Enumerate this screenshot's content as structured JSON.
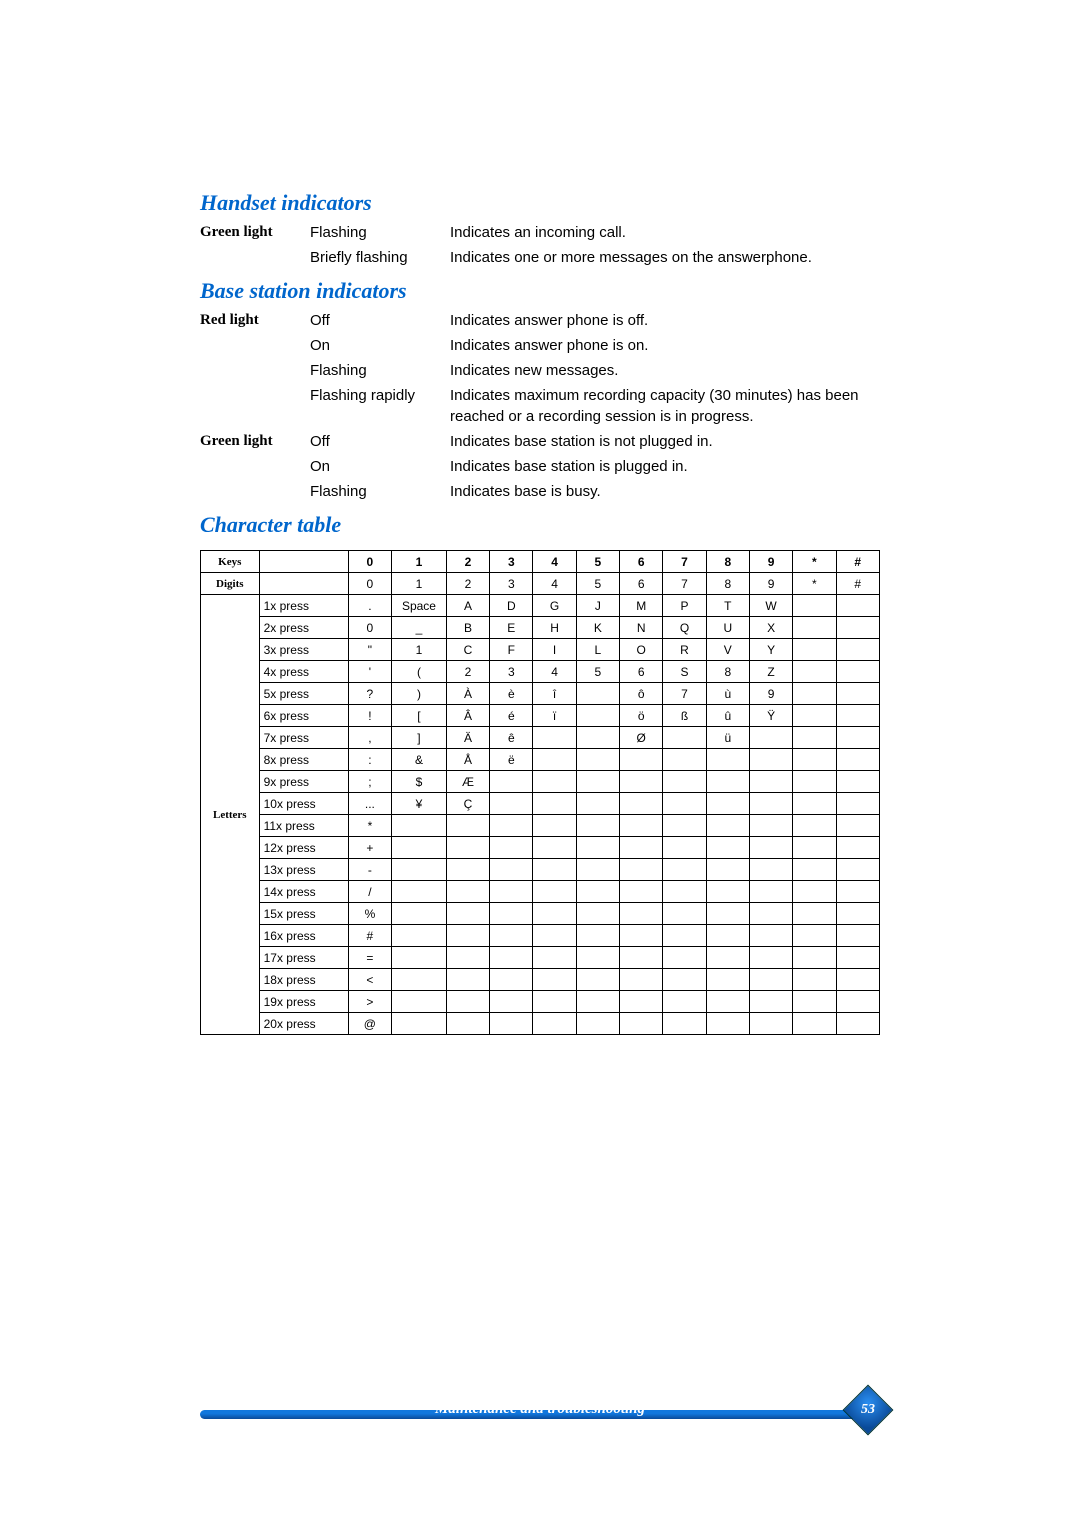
{
  "handset": {
    "title": "Handset indicators",
    "rows": [
      {
        "label": "Green light",
        "state": "Flashing",
        "desc": "Indicates an incoming call."
      },
      {
        "label": "",
        "state": "Briefly flashing",
        "desc": "Indicates one or more messages on the answerphone."
      }
    ]
  },
  "base": {
    "title": "Base station indicators",
    "rows": [
      {
        "label": "Red light",
        "state": "Off",
        "desc": "Indicates answer phone is off."
      },
      {
        "label": "",
        "state": "On",
        "desc": "Indicates answer phone is on."
      },
      {
        "label": "",
        "state": "Flashing",
        "desc": " Indicates new messages."
      },
      {
        "label": "",
        "state": "Flashing rapidly",
        "desc": " Indicates maximum recording capacity (30 minutes) has been reached or a recording session is in progress."
      },
      {
        "label": "Green light",
        "state": "Off",
        "desc": "Indicates base station is not plugged in."
      },
      {
        "label": "",
        "state": "On",
        "desc": "Indicates base station is plugged in."
      },
      {
        "label": "",
        "state": "Flashing",
        "desc": " Indicates base is busy."
      }
    ]
  },
  "chartable": {
    "title": "Character table",
    "headers": {
      "keys": "Keys",
      "digits": "Digits",
      "letters": "Letters",
      "cols": [
        "0",
        "1",
        "2",
        "3",
        "4",
        "5",
        "6",
        "7",
        "8",
        "9",
        "*",
        "#"
      ]
    },
    "digits_row": [
      "0",
      "1",
      "2",
      "3",
      "4",
      "5",
      "6",
      "7",
      "8",
      "9",
      "*",
      "#"
    ],
    "rows": [
      {
        "press": "1x press",
        "cells": [
          ".",
          "Space",
          "A",
          "D",
          "G",
          "J",
          "M",
          "P",
          "T",
          "W",
          "",
          ""
        ]
      },
      {
        "press": "2x press",
        "cells": [
          "0",
          "_",
          "B",
          "E",
          "H",
          "K",
          "N",
          "Q",
          "U",
          "X",
          "",
          ""
        ]
      },
      {
        "press": "3x press",
        "cells": [
          "\"",
          "1",
          "C",
          "F",
          "I",
          "L",
          "O",
          "R",
          "V",
          "Y",
          "",
          ""
        ]
      },
      {
        "press": "4x press",
        "cells": [
          "'",
          "(",
          "2",
          "3",
          "4",
          "5",
          "6",
          "S",
          "8",
          "Z",
          "",
          ""
        ]
      },
      {
        "press": "5x press",
        "cells": [
          "?",
          ")",
          "À",
          "è",
          "î",
          "",
          "ô",
          "7",
          "ù",
          "9",
          "",
          ""
        ]
      },
      {
        "press": "6x press",
        "cells": [
          "!",
          "[",
          "Â",
          "é",
          "ï",
          "",
          "ö",
          "ß",
          "û",
          "Ÿ",
          "",
          ""
        ]
      },
      {
        "press": "7x press",
        "cells": [
          ",",
          "]",
          "Ä",
          "ê",
          "",
          "",
          "Ø",
          "",
          "ü",
          "",
          "",
          ""
        ]
      },
      {
        "press": "8x press",
        "cells": [
          ":",
          "&",
          "Å",
          "ë",
          "",
          "",
          "",
          "",
          "",
          "",
          "",
          ""
        ]
      },
      {
        "press": "9x press",
        "cells": [
          ";",
          "$",
          "Æ",
          "",
          "",
          "",
          "",
          "",
          "",
          "",
          "",
          ""
        ]
      },
      {
        "press": "10x press",
        "cells": [
          "...",
          "¥",
          "Ç",
          "",
          "",
          "",
          "",
          "",
          "",
          "",
          "",
          ""
        ]
      },
      {
        "press": "11x press",
        "cells": [
          "*",
          "",
          "",
          "",
          "",
          "",
          "",
          "",
          "",
          "",
          "",
          ""
        ]
      },
      {
        "press": "12x press",
        "cells": [
          "+",
          "",
          "",
          "",
          "",
          "",
          "",
          "",
          "",
          "",
          "",
          ""
        ]
      },
      {
        "press": "13x press",
        "cells": [
          "-",
          "",
          "",
          "",
          "",
          "",
          "",
          "",
          "",
          "",
          "",
          ""
        ]
      },
      {
        "press": "14x press",
        "cells": [
          "/",
          "",
          "",
          "",
          "",
          "",
          "",
          "",
          "",
          "",
          "",
          ""
        ]
      },
      {
        "press": "15x press",
        "cells": [
          "%",
          "",
          "",
          "",
          "",
          "",
          "",
          "",
          "",
          "",
          "",
          ""
        ]
      },
      {
        "press": "16x press",
        "cells": [
          "#",
          "",
          "",
          "",
          "",
          "",
          "",
          "",
          "",
          "",
          "",
          ""
        ]
      },
      {
        "press": "17x press",
        "cells": [
          "=",
          "",
          "",
          "",
          "",
          "",
          "",
          "",
          "",
          "",
          "",
          ""
        ]
      },
      {
        "press": "18x press",
        "cells": [
          "<",
          "",
          "",
          "",
          "",
          "",
          "",
          "",
          "",
          "",
          "",
          ""
        ]
      },
      {
        "press": "19x press",
        "cells": [
          ">",
          "",
          "",
          "",
          "",
          "",
          "",
          "",
          "",
          "",
          "",
          ""
        ]
      },
      {
        "press": "20x press",
        "cells": [
          "@",
          "",
          "",
          "",
          "",
          "",
          "",
          "",
          "",
          "",
          "",
          ""
        ]
      }
    ]
  },
  "footer": {
    "text": "Maintenance and troubleshooting",
    "page": "53"
  }
}
